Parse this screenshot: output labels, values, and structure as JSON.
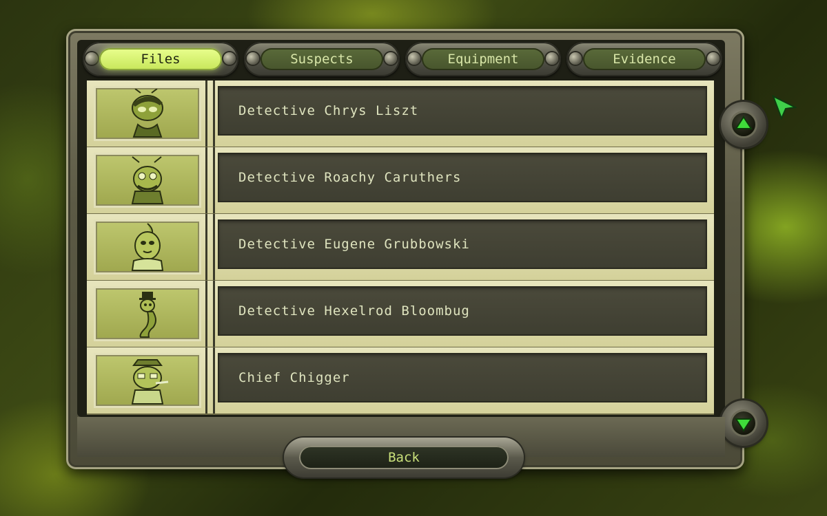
{
  "tabs": [
    {
      "label": "Files",
      "active": true
    },
    {
      "label": "Suspects",
      "active": false
    },
    {
      "label": "Equipment",
      "active": false
    },
    {
      "label": "Evidence",
      "active": false
    }
  ],
  "files": [
    {
      "name": "Detective Chrys Liszt",
      "portrait": "ant-detective-portrait"
    },
    {
      "name": "Detective Roachy Caruthers",
      "portrait": "roach-detective-portrait"
    },
    {
      "name": "Detective Eugene Grubbowski",
      "portrait": "grub-detective-portrait"
    },
    {
      "name": "Detective Hexelrod Bloombug",
      "portrait": "worm-detective-portrait"
    },
    {
      "name": "Chief Chigger",
      "portrait": "chigger-chief-portrait"
    }
  ],
  "footer": {
    "back_label": "Back"
  },
  "scroll": {
    "up_icon": "scroll-up-arrow-icon",
    "down_icon": "scroll-down-arrow-icon"
  },
  "colors": {
    "accent": "#c7e65a",
    "panel": "#d9d6a4",
    "name_box": "#3e3e31"
  }
}
